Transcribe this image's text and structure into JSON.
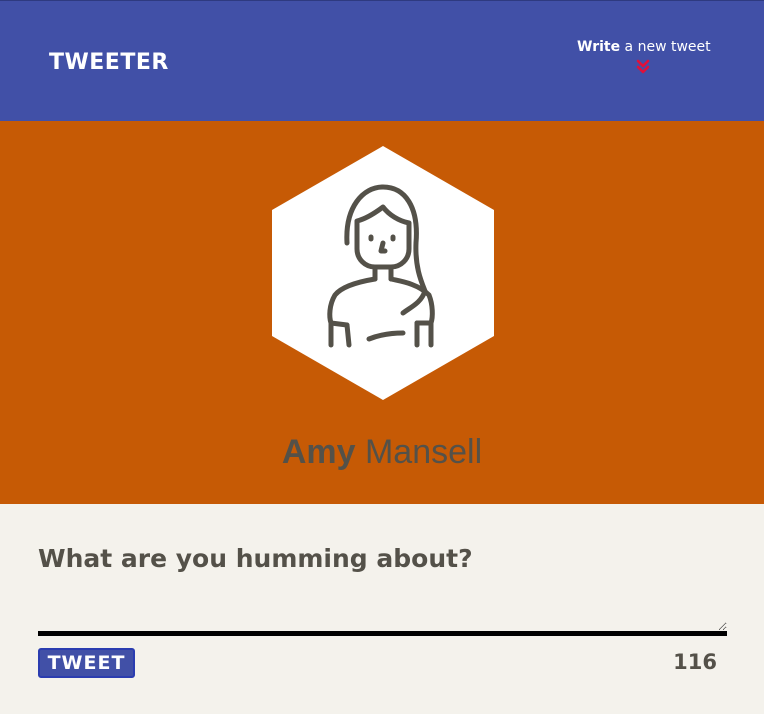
{
  "header": {
    "logo": "TWEETER",
    "compose_toggle": {
      "strong": "Write",
      "rest": "a new tweet",
      "icon": "double-chevron-down-icon",
      "icon_color": "#e0103a"
    },
    "background": "#4150a7"
  },
  "profile": {
    "background": "#c65a05",
    "avatar_icon": "user-avatar-icon",
    "first_name": "Amy",
    "last_name": "Mansell"
  },
  "compose": {
    "placeholder": "What are you humming about?",
    "value": "",
    "button_label": "TWEET",
    "char_counter": "116"
  },
  "colors": {
    "accent": "#4150a7",
    "text": "#545149",
    "compose_bg": "#f4f2ec"
  }
}
